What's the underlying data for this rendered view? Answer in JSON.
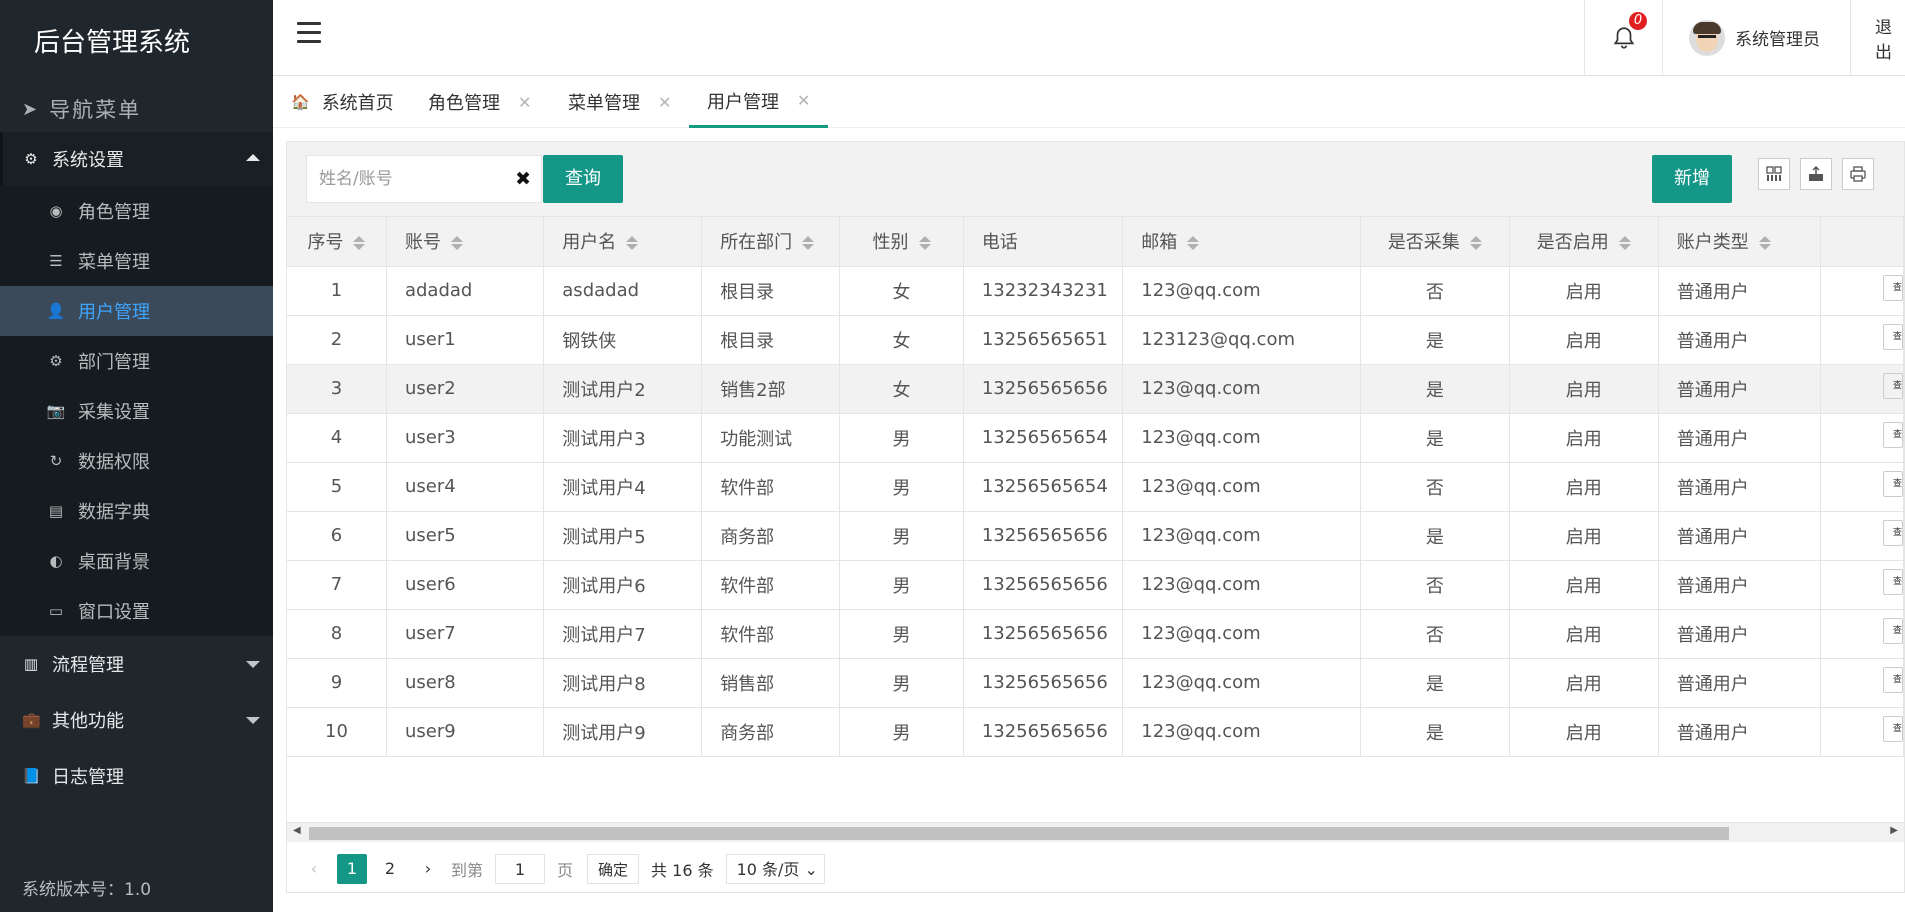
{
  "app": {
    "title": "后台管理系统",
    "version_label": "系统版本号：1.0"
  },
  "sidebar": {
    "nav_title": "导航菜单",
    "groups": [
      {
        "label": "系统设置",
        "icon": "gear-icon",
        "expanded": true
      },
      {
        "label": "流程管理",
        "icon": "barcode-icon",
        "expanded": false
      },
      {
        "label": "其他功能",
        "icon": "briefcase-icon",
        "expanded": false
      },
      {
        "label": "日志管理",
        "icon": "book-icon",
        "expanded": false
      }
    ],
    "sub_items": [
      {
        "label": "角色管理",
        "icon": "circle-dot-icon"
      },
      {
        "label": "菜单管理",
        "icon": "menu-list-icon"
      },
      {
        "label": "用户管理",
        "icon": "user-icon",
        "active": true
      },
      {
        "label": "部门管理",
        "icon": "gears-icon"
      },
      {
        "label": "采集设置",
        "icon": "camera-icon"
      },
      {
        "label": "数据权限",
        "icon": "refresh-icon"
      },
      {
        "label": "数据字典",
        "icon": "list-alt-icon"
      },
      {
        "label": "桌面背景",
        "icon": "palette-icon"
      },
      {
        "label": "窗口设置",
        "icon": "window-icon"
      }
    ]
  },
  "header": {
    "notification_count": "0",
    "user_name": "系统管理员",
    "logout_label": "退出"
  },
  "tabs": [
    {
      "label": "系统首页",
      "closable": false
    },
    {
      "label": "角色管理",
      "closable": true
    },
    {
      "label": "菜单管理",
      "closable": true
    },
    {
      "label": "用户管理",
      "closable": true,
      "active": true
    }
  ],
  "toolbar": {
    "search_placeholder": "姓名/账号",
    "query_label": "查询",
    "add_label": "新增"
  },
  "table": {
    "columns": [
      "序号",
      "账号",
      "用户名",
      "所在部门",
      "性别",
      "电话",
      "邮箱",
      "是否采集",
      "是否启用",
      "账户类型"
    ],
    "rows": [
      [
        "1",
        "adadad",
        "asdadad",
        "根目录",
        "女",
        "13232343231",
        "123@qq.com",
        "否",
        "启用",
        "普通用户"
      ],
      [
        "2",
        "user1",
        "钢铁侠",
        "根目录",
        "女",
        "13256565651",
        "123123@qq.com",
        "是",
        "启用",
        "普通用户"
      ],
      [
        "3",
        "user2",
        "测试用户2",
        "销售2部",
        "女",
        "13256565656",
        "123@qq.com",
        "是",
        "启用",
        "普通用户"
      ],
      [
        "4",
        "user3",
        "测试用户3",
        "功能测试",
        "男",
        "13256565654",
        "123@qq.com",
        "是",
        "启用",
        "普通用户"
      ],
      [
        "5",
        "user4",
        "测试用户4",
        "软件部",
        "男",
        "13256565654",
        "123@qq.com",
        "否",
        "启用",
        "普通用户"
      ],
      [
        "6",
        "user5",
        "测试用户5",
        "商务部",
        "男",
        "13256565656",
        "123@qq.com",
        "是",
        "启用",
        "普通用户"
      ],
      [
        "7",
        "user6",
        "测试用户6",
        "软件部",
        "男",
        "13256565656",
        "123@qq.com",
        "否",
        "启用",
        "普通用户"
      ],
      [
        "8",
        "user7",
        "测试用户7",
        "软件部",
        "男",
        "13256565656",
        "123@qq.com",
        "否",
        "启用",
        "普通用户"
      ],
      [
        "9",
        "user8",
        "测试用户8",
        "销售部",
        "男",
        "13256565656",
        "123@qq.com",
        "是",
        "启用",
        "普通用户"
      ],
      [
        "10",
        "user9",
        "测试用户9",
        "商务部",
        "男",
        "13256565656",
        "123@qq.com",
        "是",
        "启用",
        "普通用户"
      ]
    ],
    "row_action_label": "查"
  },
  "pagination": {
    "pages": [
      "1",
      "2"
    ],
    "goto_label": "到第",
    "goto_value": "1",
    "page_unit": "页",
    "confirm_label": "确定",
    "total_label": "共 16 条",
    "page_size_label": "10 条/页"
  },
  "colors": {
    "accent": "#149787",
    "sidebar_bg": "#20272c",
    "active_item_bg": "#3b4a5b",
    "active_item_text": "#3ea5ff"
  }
}
